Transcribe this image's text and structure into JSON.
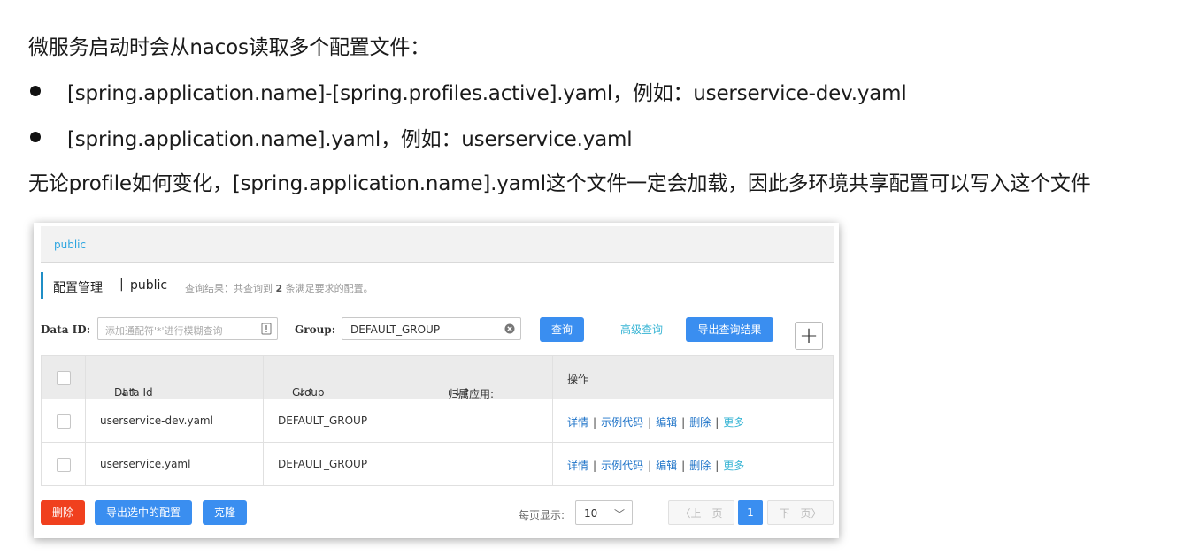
{
  "text": {
    "line1": "微服务启动时会从nacos读取多个配置文件：",
    "bullets": [
      "[spring.application.name]-[spring.profiles.active].yaml，例如：userservice-dev.yaml",
      "[spring.application.name].yaml，例如：userservice.yaml"
    ],
    "line4": "无论profile如何变化，[spring.application.name].yaml这个文件一定会加载，因此多环境共享配置可以写入这个文件"
  },
  "nacos": {
    "namespace": "public",
    "title": "配置管理",
    "sep": "|",
    "namespace_label": "public",
    "result_prefix": "查询结果：共查询到",
    "result_count": "2",
    "result_suffix": "条满足要求的配置。",
    "search": {
      "dataid_label": "Data ID:",
      "dataid_placeholder": "添加通配符'*'进行模糊查询",
      "group_label": "Group:",
      "group_value": "DEFAULT_GROUP",
      "query_button": "查询",
      "advanced_query": "高级查询",
      "export_button": "导出查询结果",
      "add_button": "+"
    },
    "table": {
      "headers": [
        "Data Id",
        "Group",
        "归属应用:",
        "操作"
      ],
      "sort_icon": "↓↑",
      "rows": [
        {
          "data_id": "userservice-dev.yaml",
          "group": "DEFAULT_GROUP",
          "app": ""
        },
        {
          "data_id": "userservice.yaml",
          "group": "DEFAULT_GROUP",
          "app": ""
        }
      ],
      "ops": [
        "详情",
        "示例代码",
        "编辑",
        "删除",
        "更多"
      ]
    },
    "footer": {
      "delete_button": "删除",
      "export_selected_button": "导出选中的配置",
      "clone_button": "克隆",
      "page_size_label": "每页显示:",
      "page_size": "10",
      "prev": "上一页",
      "current_page": "1",
      "next": "下一页"
    },
    "colors": {
      "primary": "#3a8ef0",
      "danger": "#f0401e",
      "link": "#1e73c8",
      "accent": "#37b4d4"
    }
  }
}
